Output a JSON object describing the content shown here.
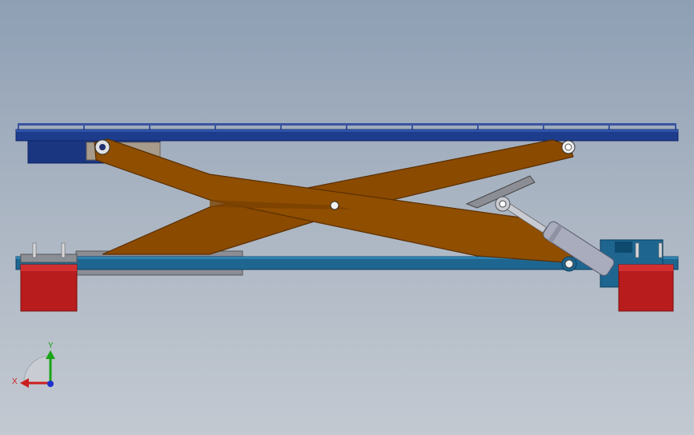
{
  "triad": {
    "x_label": "X",
    "y_label": "Y",
    "x_color": "#cc1f1f",
    "y_color": "#19a319",
    "z_color": "#1f2fcc"
  },
  "colors": {
    "platform": "#1d3d8c",
    "platform_dark": "#0e2466",
    "rail": "#4a5fa8",
    "scissor_arm": "#8a4a00",
    "scissor_edge": "#5a2f00",
    "base_frame": "#1e6690",
    "base_frame_dark": "#0c3f60",
    "roller": "#b81c1c",
    "roller_dark": "#7d0f0f",
    "cylinder": "#a8acbd",
    "slide_plate": "#8c8e96"
  }
}
